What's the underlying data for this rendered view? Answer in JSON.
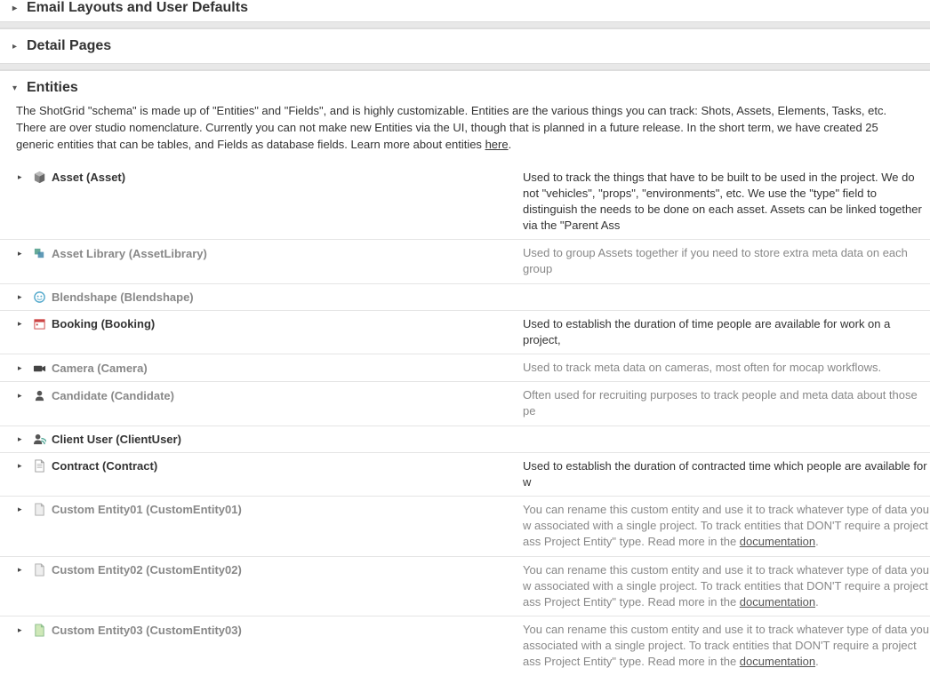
{
  "sections": {
    "email_layouts": {
      "title": "Email Layouts and User Defaults"
    },
    "detail_pages": {
      "title": "Detail Pages"
    },
    "entities": {
      "title": "Entities",
      "description": "The ShotGrid \"schema\" is made up of \"Entities\" and \"Fields\", and is highly customizable. Entities are the various things you can track: Shots, Assets, Elements, Tasks, etc. There are over studio nomenclature. Currently you can not make new Entities via the UI, though that is planned in a future release. In the short term, we have created 25 generic entities that can be tables, and Fields as database fields. Learn more about entities ",
      "link_label": "here"
    }
  },
  "entities": [
    {
      "name": "Asset (Asset)",
      "muted": false,
      "desc_muted": false,
      "desc": "Used to track the things that have to be built to be used in the project. We do not \"vehicles\", \"props\", \"environments\", etc. We use the \"type\" field to distinguish the needs to be done on each asset. Assets can be linked together via the \"Parent Ass"
    },
    {
      "name": "Asset Library (AssetLibrary)",
      "muted": true,
      "desc_muted": true,
      "desc": "Used to group Assets together if you need to store extra meta data on each group"
    },
    {
      "name": "Blendshape (Blendshape)",
      "muted": true,
      "desc_muted": true,
      "desc": ""
    },
    {
      "name": "Booking (Booking)",
      "muted": false,
      "desc_muted": false,
      "desc": "Used to establish the duration of time people are available for work on a project,"
    },
    {
      "name": "Camera (Camera)",
      "muted": true,
      "desc_muted": true,
      "desc": "Used to track meta data on cameras, most often for mocap workflows."
    },
    {
      "name": "Candidate (Candidate)",
      "muted": true,
      "desc_muted": true,
      "desc": "Often used for recruiting purposes to track people and meta data about those pe"
    },
    {
      "name": "Client User (ClientUser)",
      "muted": false,
      "desc_muted": false,
      "desc": ""
    },
    {
      "name": "Contract (Contract)",
      "muted": false,
      "desc_muted": false,
      "desc": "Used to establish the duration of contracted time which people are available for w"
    },
    {
      "name": "Custom Entity01 (CustomEntity01)",
      "muted": true,
      "desc_muted": true,
      "desc": "You can rename this custom entity and use it to track whatever type of data you w associated with a single project. To track entities that DON'T require a project ass Project Entity\" type. Read more in the ",
      "link": "documentation"
    },
    {
      "name": "Custom Entity02 (CustomEntity02)",
      "muted": true,
      "desc_muted": true,
      "desc": "You can rename this custom entity and use it to track whatever type of data you w associated with a single project. To track entities that DON'T require a project ass Project Entity\" type. Read more in the ",
      "link": "documentation"
    },
    {
      "name": "Custom Entity03 (CustomEntity03)",
      "muted": true,
      "desc_muted": true,
      "desc": "You can rename this custom entity and use it to track whatever type of data you associated with a single project. To track entities that DON'T require a project ass Project Entity\" type. Read more in the ",
      "link": "documentation"
    }
  ],
  "icons": {
    "asset": "cube",
    "assetlibrary": "stack",
    "blendshape": "face",
    "booking": "calendar",
    "camera": "camera",
    "candidate": "person",
    "clientuser": "person-rss",
    "contract": "doc",
    "custom1": "doc-gray",
    "custom2": "doc-gray",
    "custom3": "doc-green"
  }
}
